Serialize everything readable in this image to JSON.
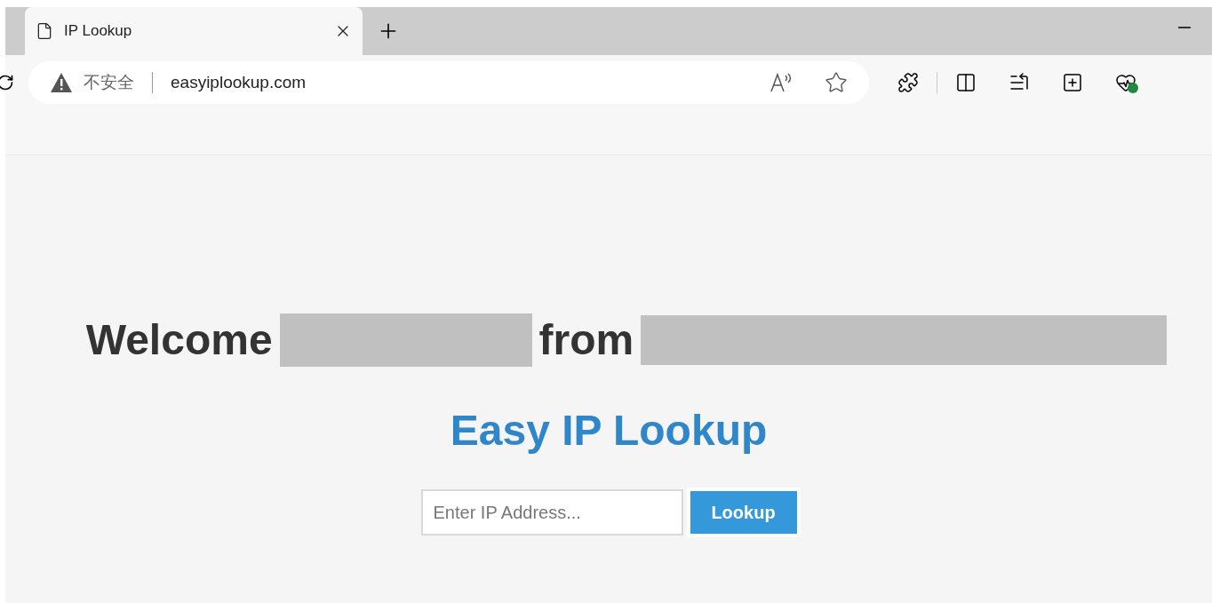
{
  "tabs": [
    {
      "title": "IP Lookup",
      "selected": true
    }
  ],
  "address_bar": {
    "security": "不安全",
    "url": "easyiplookup.com"
  },
  "page": {
    "welcome": "Welcome",
    "from": "from",
    "heading": "Easy IP Lookup",
    "search": {
      "placeholder": "Enter IP Address..."
    },
    "button": "Lookup"
  }
}
